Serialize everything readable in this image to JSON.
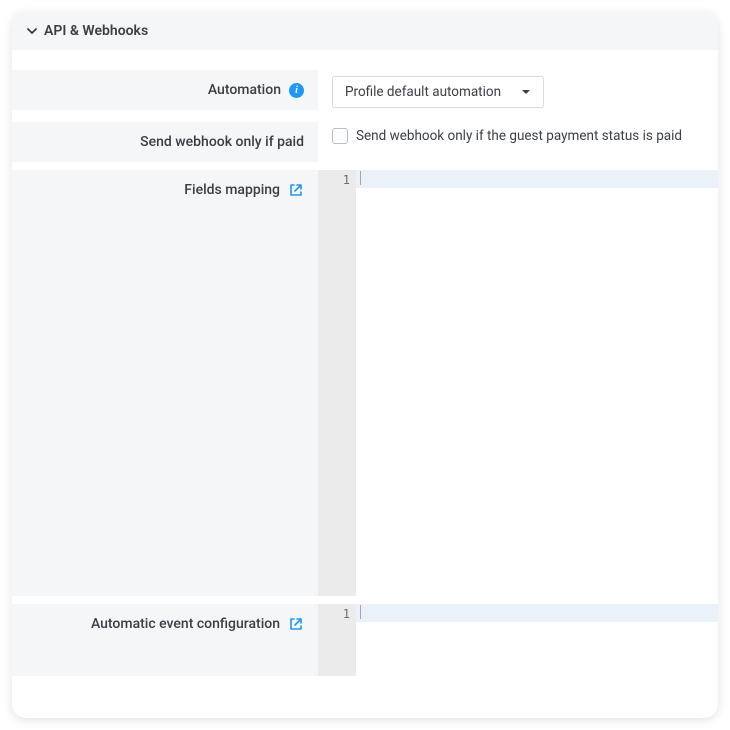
{
  "section": {
    "title": "API & Webhooks",
    "expanded": true
  },
  "rows": {
    "automation": {
      "label": "Automation",
      "selected": "Profile default automation"
    },
    "send_webhook_paid": {
      "label": "Send webhook only if paid",
      "checkbox_label": "Send webhook only if the guest payment status is paid",
      "checked": false
    },
    "fields_mapping": {
      "label": "Fields mapping",
      "editor": {
        "line_number": "1",
        "content": ""
      }
    },
    "auto_event_config": {
      "label": "Automatic event configuration",
      "editor": {
        "line_number": "1",
        "content": ""
      }
    }
  },
  "colors": {
    "accent": "#2196f3",
    "panel_bg": "#f5f6f7",
    "gutter_bg": "#ebebeb",
    "active_line": "#eaf1f8"
  }
}
